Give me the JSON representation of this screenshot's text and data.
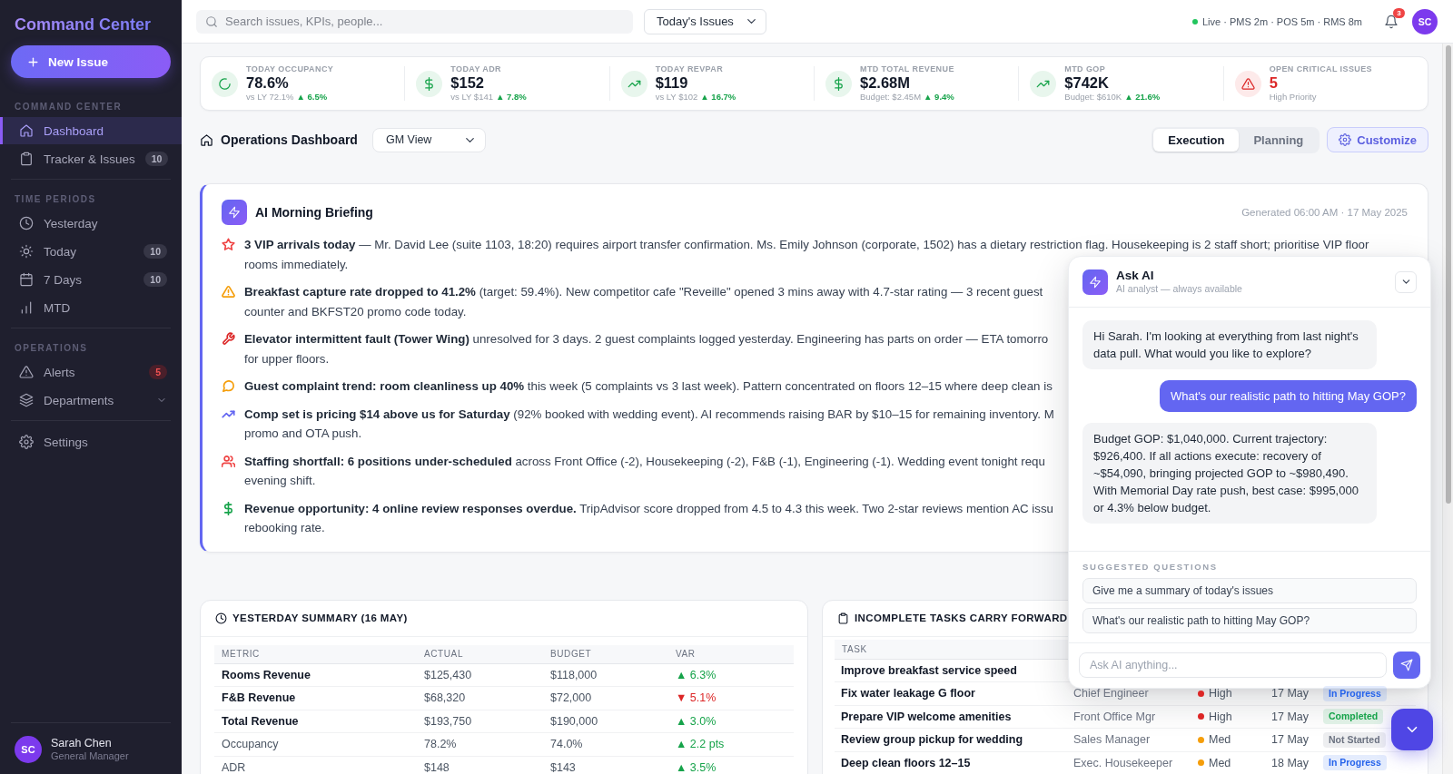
{
  "sidebar": {
    "title": "Command Center",
    "new_issue_button": {
      "label": "New Issue"
    },
    "sections": [
      {
        "heading": "COMMAND CENTER",
        "items": [
          {
            "label": "Dashboard",
            "selected": true
          },
          {
            "label": "Tracker & Issues",
            "selected": false,
            "badge": {
              "text": "10",
              "kind": "count"
            }
          }
        ]
      },
      {
        "heading": "TIME PERIODS",
        "items": [
          {
            "label": "Yesterday",
            "selected": false
          },
          {
            "label": "Today",
            "selected": false,
            "badge": {
              "text": "10",
              "kind": "count"
            }
          },
          {
            "label": "7 Days",
            "selected": false,
            "badge": {
              "text": "10",
              "kind": "count"
            }
          },
          {
            "label": "MTD",
            "selected": false
          }
        ]
      },
      {
        "heading": "OPERATIONS",
        "items": [
          {
            "label": "Alerts",
            "selected": false,
            "badge": {
              "text": "5",
              "kind": "alert"
            }
          },
          {
            "label": "Departments",
            "selected": false,
            "expanded": false
          }
        ]
      },
      {
        "items": [
          {
            "label": "Settings",
            "selected": false
          }
        ]
      }
    ],
    "user": {
      "initials": "SC",
      "name": "Sarah Chen",
      "role": "General Manager"
    }
  },
  "topbar": {
    "search": {
      "placeholder": "Search issues, KPIs, people..."
    },
    "issue_filter": {
      "value": "Today's Issues"
    },
    "sync_status": "Live · PMS 2m · POS 5m · RMS 8m",
    "notifications": {
      "count": "3"
    },
    "user": {
      "initials": "SC"
    }
  },
  "kpis": [
    {
      "kind": "metric",
      "label": "TODAY OCCUPANCY",
      "value": "78.6%",
      "comparison": "vs LY 72.1%",
      "change": "▲ 6.5%",
      "positive": true
    },
    {
      "kind": "metric",
      "label": "TODAY ADR",
      "value": "$152",
      "comparison": "vs LY $141",
      "change": "▲ 7.8%",
      "positive": true
    },
    {
      "kind": "metric",
      "label": "TODAY REVPAR",
      "value": "$119",
      "comparison": "vs LY $102",
      "change": "▲ 16.7%",
      "positive": true
    },
    {
      "kind": "metric",
      "label": "MTD TOTAL REVENUE",
      "value": "$2.68M",
      "comparison": "Budget: $2.45M",
      "change": "▲ 9.4%",
      "positive": true
    },
    {
      "kind": "metric",
      "label": "MTD GOP",
      "value": "$742K",
      "comparison": "Budget: $610K",
      "change": "▲ 21.6%",
      "positive": true
    },
    {
      "kind": "critical",
      "label": "OPEN CRITICAL ISSUES",
      "value": "5",
      "comparison": "High Priority"
    }
  ],
  "dashboard_header": {
    "title": "Operations Dashboard",
    "view": {
      "value": "GM View"
    },
    "modes": [
      {
        "label": "Execution",
        "selected": true
      },
      {
        "label": "Planning",
        "selected": false
      }
    ],
    "customize_button": {
      "label": "Customize"
    }
  },
  "briefing": {
    "title": "AI Morning Briefing",
    "generated": "Generated 06:00 AM · 17 May 2025",
    "items": [
      {
        "color": "#ef4444",
        "lines": [
          "**3 VIP arrivals today** — Mr. David Lee (suite 1103, 18:20) requires airport transfer confirmation. Ms. Emily Johnson (corporate, 1502) has a dietary restriction flag. Housekeeping is 2 staff short; prioritise VIP floor",
          "rooms immediately."
        ]
      },
      {
        "color": "#f59e0b",
        "lines": [
          "**Breakfast capture rate dropped to 41.2%** (target: 59.4%). New competitor cafe \"Reveille\" opened 3 mins away with 4.7-star rating — 3 recent guest",
          "counter and BKFST20 promo code today."
        ]
      },
      {
        "color": "#dc2626",
        "lines": [
          "**Elevator intermittent fault (Tower Wing)** unresolved for 3 days. 2 guest complaints logged yesterday. Engineering has parts on order — ETA tomorro",
          "for upper floors."
        ]
      },
      {
        "color": "#f59e0b",
        "lines": [
          "**Guest complaint trend: room cleanliness up 40%** this week (5 complaints vs 3 last week). Pattern concentrated on floors 12–15 where deep clean is"
        ]
      },
      {
        "color": "#6366f1",
        "lines": [
          "**Comp set is pricing $14 above us for Saturday** (92% booked with wedding event). AI recommends raising BAR by $10–15 for remaining inventory. M",
          "promo and OTA push."
        ]
      },
      {
        "color": "#ef4444",
        "lines": [
          "**Staffing shortfall: 6 positions under-scheduled** across Front Office (-2), Housekeeping (-2), F&B (-1), Engineering (-1). Wedding event tonight requ",
          "evening shift."
        ]
      },
      {
        "color": "#16a34a",
        "lines": [
          "**Revenue opportunity: 4 online review responses overdue.** TripAdvisor score dropped from 4.5 to 4.3 this week. Two 2-star reviews mention AC issu",
          "rebooking rate."
        ]
      }
    ]
  },
  "yesterday_summary": {
    "title": "YESTERDAY SUMMARY (16 MAY)",
    "columns": [
      "METRIC",
      "ACTUAL",
      "BUDGET",
      "VAR"
    ],
    "rows": [
      {
        "metric": "Rooms Revenue",
        "emphasis": true,
        "actual": "$125,430",
        "budget": "$118,000",
        "var": "▲ 6.3%",
        "positive": true
      },
      {
        "metric": "F&B Revenue",
        "emphasis": true,
        "actual": "$68,320",
        "budget": "$72,000",
        "var": "▼ 5.1%",
        "positive": false
      },
      {
        "metric": "Total Revenue",
        "emphasis": true,
        "actual": "$193,750",
        "budget": "$190,000",
        "var": "▲ 3.0%",
        "positive": true
      },
      {
        "metric": "Occupancy",
        "emphasis": false,
        "actual": "78.2%",
        "budget": "74.0%",
        "var": "▲ 2.2 pts",
        "positive": true
      },
      {
        "metric": "ADR",
        "emphasis": false,
        "actual": "$148",
        "budget": "$143",
        "var": "▲ 3.5%",
        "positive": true
      }
    ]
  },
  "carry_forward_tasks": {
    "title": "INCOMPLETE TASKS CARRY FORWARD",
    "columns": [
      "TASK"
    ],
    "rows": [
      {
        "task": "Improve breakfast service speed"
      },
      {
        "task": "Fix water leakage G floor",
        "column_2": "Chief Engineer",
        "column_3": {
          "label": "High",
          "color": "#dc2626"
        },
        "column_4": "17 May",
        "column_5": {
          "label": "In Progress",
          "color": "#2563eb"
        }
      },
      {
        "task": "Prepare VIP welcome amenities",
        "column_2": "Front Office Mgr",
        "column_3": {
          "label": "High",
          "color": "#dc2626"
        },
        "column_4": "17 May",
        "column_5": {
          "label": "Completed",
          "color": "#16a34a"
        }
      },
      {
        "task": "Review group pickup for wedding",
        "column_2": "Sales Manager",
        "column_3": {
          "label": "Med",
          "color": "#f59e0b"
        },
        "column_4": "17 May",
        "column_5": {
          "label": "Not Started",
          "color": "#6b7280"
        }
      },
      {
        "task": "Deep clean floors 12–15",
        "column_2": "Exec. Housekeeper",
        "column_3": {
          "label": "Med",
          "color": "#f59e0b"
        },
        "column_4": "18 May",
        "column_5": {
          "label": "In Progress",
          "color": "#2563eb"
        }
      }
    ]
  },
  "ask_ai": {
    "title": "Ask AI",
    "subtitle": "AI analyst — always available",
    "messages": [
      {
        "kind": "ai",
        "text": "Hi Sarah. I'm looking at everything from last night's data pull. What would you like to explore?"
      },
      {
        "kind": "user",
        "text": "What's our realistic path to hitting May GOP?"
      },
      {
        "kind": "ai",
        "text": "Budget GOP: $1,040,000. Current trajectory: $926,400. If all actions execute: recovery of ~$54,090, bringing projected GOP to ~$980,490. With Memorial Day rate push, best case: $995,000 or 4.3% below budget."
      }
    ],
    "suggestions_heading": "SUGGESTED QUESTIONS",
    "suggestions": [
      "Give me a summary of today's issues",
      "What's our realistic path to hitting May GOP?"
    ],
    "input": {
      "placeholder": "Ask AI anything..."
    }
  }
}
